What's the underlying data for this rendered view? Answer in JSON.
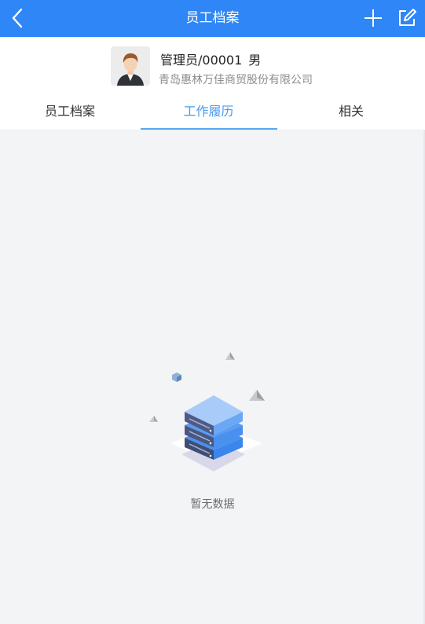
{
  "header": {
    "title": "员工档案",
    "back_icon": "chevron-left-icon",
    "add_icon": "plus-icon",
    "edit_icon": "edit-icon",
    "background_color": "#2f86f6"
  },
  "profile": {
    "name": "管理员/00001",
    "gender": "男",
    "company": "青岛惠林万佳商贸股份有限公司",
    "avatar_icon": "user-avatar"
  },
  "tabs": [
    {
      "label": "员工档案",
      "active": false
    },
    {
      "label": "工作履历",
      "active": true
    },
    {
      "label": "相关",
      "active": false
    }
  ],
  "active_tab_color": "#4a9bf0",
  "empty_state": {
    "text": "暂无数据",
    "icon": "empty-data-server-illustration"
  }
}
